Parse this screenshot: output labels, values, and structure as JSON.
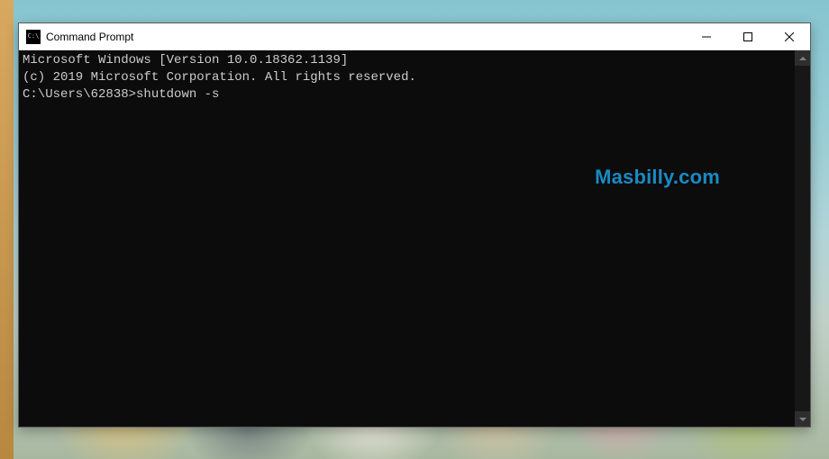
{
  "window": {
    "title": "Command Prompt"
  },
  "terminal": {
    "line1": "Microsoft Windows [Version 10.0.18362.1139]",
    "line2": "(c) 2019 Microsoft Corporation. All rights reserved.",
    "blank": "",
    "prompt": "C:\\Users\\62838>",
    "command": "shutdown -s"
  },
  "watermark": {
    "text": "Masbilly.com",
    "color": "#1a8ac4"
  }
}
